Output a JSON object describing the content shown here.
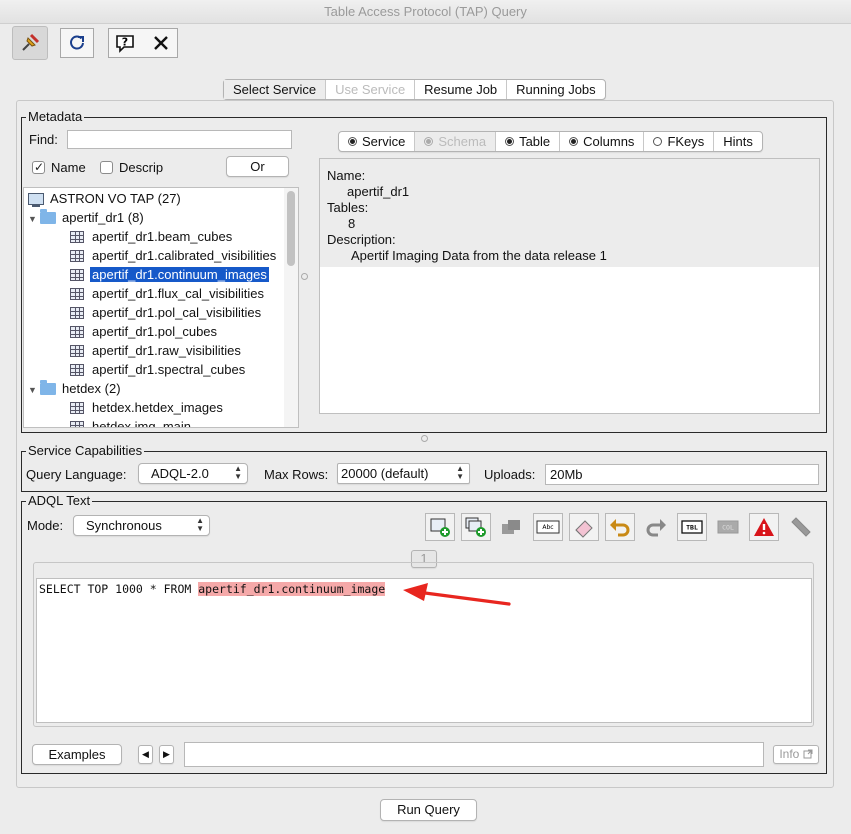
{
  "window": {
    "title": "Table Access Protocol (TAP) Query"
  },
  "toolbar": {
    "icons": [
      "pin-icon",
      "reload-icon",
      "help-icon",
      "close-icon"
    ]
  },
  "tabs": [
    "Select Service",
    "Use Service",
    "Resume Job",
    "Running Jobs"
  ],
  "metadata": {
    "title": "Metadata",
    "find_label": "Find:",
    "find_value": "",
    "name_label": "Name",
    "descrip_label": "Descrip",
    "or_label": "Or",
    "tree": {
      "root": "ASTRON VO TAP (27)",
      "schema1": "apertif_dr1 (8)",
      "tables1": [
        "apertif_dr1.beam_cubes",
        "apertif_dr1.calibrated_visibilities",
        "apertif_dr1.continuum_images",
        "apertif_dr1.flux_cal_visibilities",
        "apertif_dr1.pol_cal_visibilities",
        "apertif_dr1.pol_cubes",
        "apertif_dr1.raw_visibilities",
        "apertif_dr1.spectral_cubes"
      ],
      "schema2": "hetdex (2)",
      "tables2": [
        "hetdex.hetdex_images",
        "hetdex.img_main"
      ]
    },
    "subtabs": [
      "Service",
      "Schema",
      "Table",
      "Columns",
      "FKeys",
      "Hints"
    ],
    "info": {
      "name_label": "Name:",
      "name_value": "apertif_dr1",
      "tables_label": "Tables:",
      "tables_value": "8",
      "desc_label": "Description:",
      "desc_value": "Apertif Imaging Data from the data release 1"
    }
  },
  "capabilities": {
    "title": "Service Capabilities",
    "query_language_label": "Query Language:",
    "query_language_value": "ADQL-2.0",
    "max_rows_label": "Max Rows:",
    "max_rows_value": "20000 (default)",
    "uploads_label": "Uploads:",
    "uploads_value": "20Mb"
  },
  "adql": {
    "title": "ADQL Text",
    "mode_label": "Mode:",
    "mode_value": "Synchronous",
    "tab_number": "1",
    "sql_prefix": "SELECT TOP 1000 * FROM ",
    "sql_table": "apertif_dr1.continuum_image",
    "examples_label": "Examples",
    "info_label": "Info",
    "icon_abc": "Abc",
    "icon_tbl": "TBL",
    "icon_col": "COL"
  },
  "run_query_label": "Run Query",
  "colors": {
    "selection": "#1659c9",
    "highlight": "#f5a9a9",
    "arrow": "#e8261f"
  }
}
